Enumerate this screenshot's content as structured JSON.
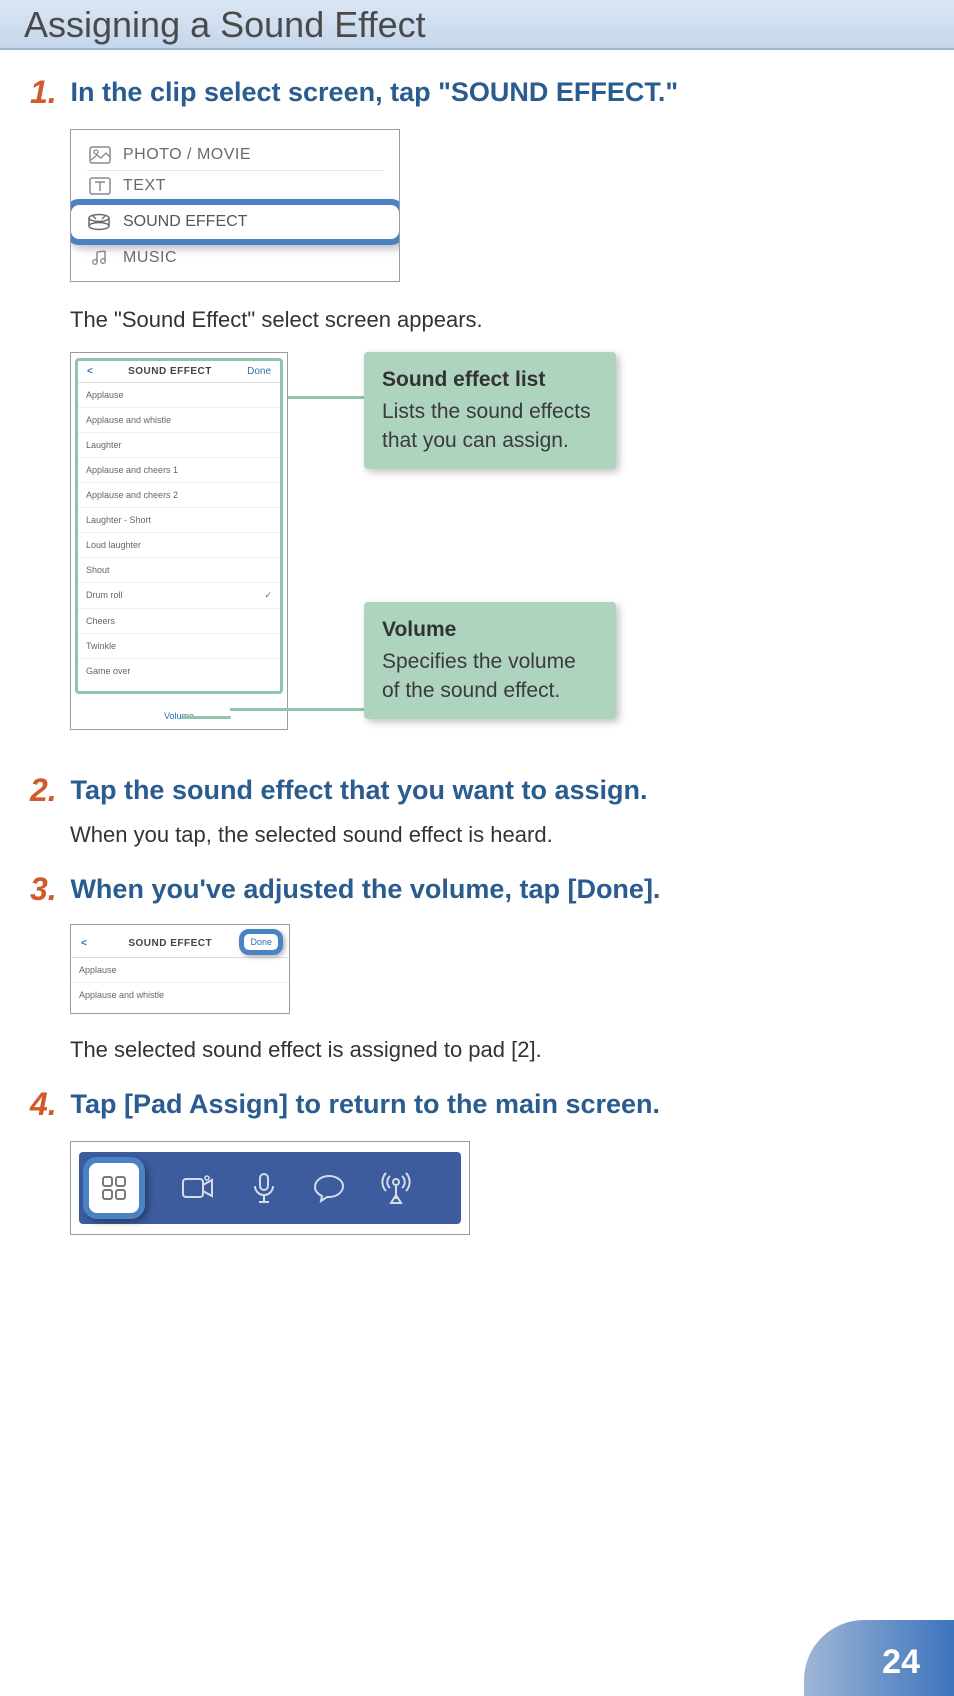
{
  "page_title": "Assigning a Sound Effect",
  "page_number": "24",
  "steps": [
    {
      "num": "1.",
      "title": "In the clip select screen, tap \"SOUND EFFECT.\"",
      "after_text": "The \"Sound Effect\" select screen appears."
    },
    {
      "num": "2.",
      "title": "Tap the sound effect that you want to assign.",
      "body": "When you tap, the selected sound effect is heard."
    },
    {
      "num": "3.",
      "title": "When you've adjusted the volume, tap [Done].",
      "after_text": "The selected sound effect is assigned to pad [2]."
    },
    {
      "num": "4.",
      "title": "Tap [Pad Assign] to return to the main screen."
    }
  ],
  "clip_menu": {
    "items": [
      "PHOTO / MOVIE",
      "TEXT",
      "SOUND EFFECT",
      "MUSIC"
    ]
  },
  "sound_effect_screen": {
    "back": "<",
    "title": "SOUND EFFECT",
    "done": "Done",
    "items": [
      "Applause",
      "Applause and whistle",
      "Laughter",
      "Applause and cheers 1",
      "Applause and cheers 2",
      "Laughter - Short",
      "Loud laughter",
      "Shout",
      "Drum roll",
      "Cheers",
      "Twinkle",
      "Game over"
    ],
    "selected_index": 8,
    "volume_label": "Volume"
  },
  "callouts": {
    "list": {
      "title": "Sound effect list",
      "body": "Lists the sound effects that you can assign."
    },
    "volume": {
      "title": "Volume",
      "body": "Specifies the volume of the sound effect."
    }
  },
  "done_screen": {
    "back": "<",
    "title": "SOUND EFFECT",
    "done": "Done",
    "items": [
      "Applause",
      "Applause and whistle"
    ]
  }
}
